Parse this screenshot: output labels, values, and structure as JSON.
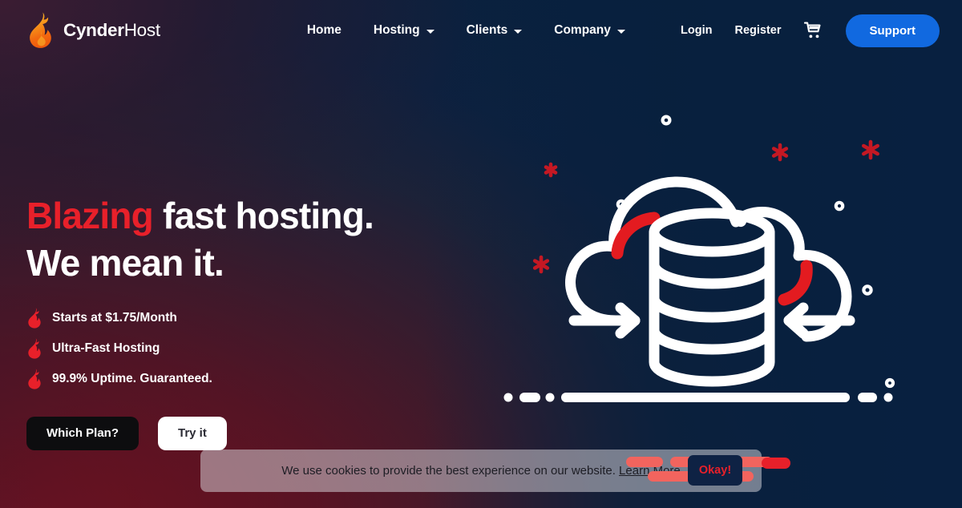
{
  "brand": {
    "name_bold": "Cynder",
    "name_light": "Host",
    "logo_icon": "flame-icon",
    "flame_color_top": "#f7a421",
    "flame_color_bottom": "#f26a10"
  },
  "nav": {
    "items": [
      {
        "label": "Home",
        "has_dropdown": false,
        "icon": ""
      },
      {
        "label": "Hosting",
        "has_dropdown": true,
        "icon": "chevron-down-icon"
      },
      {
        "label": "Clients",
        "has_dropdown": true,
        "icon": "chevron-down-icon"
      },
      {
        "label": "Company",
        "has_dropdown": true,
        "icon": "chevron-down-icon"
      }
    ],
    "login_label": "Login",
    "register_label": "Register",
    "cart_icon": "shopping-cart-icon",
    "support_label": "Support",
    "support_color": "#1169e0"
  },
  "hero": {
    "headline_line1_accent": "Blazing",
    "headline_line1_rest": " fast hosting.",
    "headline_line2": "We mean it.",
    "accent_color": "#e8202a",
    "features": [
      {
        "icon": "flame-bullet-icon",
        "text": "Starts at $1.75/Month"
      },
      {
        "icon": "flame-bullet-icon",
        "text": "Ultra-Fast Hosting"
      },
      {
        "icon": "flame-bullet-icon",
        "text": "99.9% Uptime. Guaranteed."
      }
    ],
    "primary_cta": "Which Plan?",
    "secondary_cta": "Try it"
  },
  "illustration": {
    "name": "cloud-database-illustration",
    "cloud_icon": "cloud-outline-icon",
    "database_icon": "database-cylinder-icon",
    "arrow_left_icon": "arrow-right-icon",
    "arrow_right_icon": "arrow-left-icon",
    "accent_arc_color": "#e31b20",
    "stroke_color": "#ffffff",
    "decor_rings": 7,
    "decor_asterisks": 4,
    "decor_asterisk_color": "#c41823"
  },
  "cookie_banner": {
    "message": "We use cookies to provide the best experience on our website.",
    "link_label": "Learn More",
    "accept_label": "Okay!",
    "accept_text_color": "#e8202a",
    "accept_bg_color": "#0e2244",
    "highlight_color": "#f2645e"
  }
}
